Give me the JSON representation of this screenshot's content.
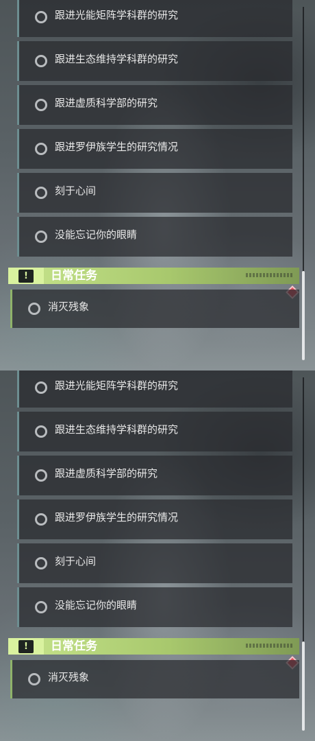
{
  "screens": [
    {
      "quests": [
        {
          "label": "跟进光能矩阵学科群的研究"
        },
        {
          "label": "跟进生态维持学科群的研究"
        },
        {
          "label": "跟进虚质科学部的研究"
        },
        {
          "label": "跟进罗伊族学生的研究情况"
        },
        {
          "label": "刻于心间"
        },
        {
          "label": "没能忘记你的眼睛"
        }
      ],
      "daily": {
        "title": "日常任务",
        "quests": [
          {
            "label": "消灭残象"
          }
        ]
      }
    },
    {
      "quests": [
        {
          "label": "跟进光能矩阵学科群的研究"
        },
        {
          "label": "跟进生态维持学科群的研究"
        },
        {
          "label": "跟进虚质科学部的研究"
        },
        {
          "label": "跟进罗伊族学生的研究情况"
        },
        {
          "label": "刻于心间"
        },
        {
          "label": "没能忘记你的眼睛"
        }
      ],
      "daily": {
        "title": "日常任务",
        "quests": [
          {
            "label": "消灭残象"
          }
        ]
      }
    }
  ],
  "icons": {
    "radio": "radio-circle-icon",
    "daily": "exclamation-box-icon",
    "tracked": "red-diamond-icon"
  },
  "colors": {
    "quest_accent": "#6d8e91",
    "daily_accent": "#c7e58d",
    "daily_border": "#8fb36a",
    "tracked_marker": "#e2505e"
  }
}
